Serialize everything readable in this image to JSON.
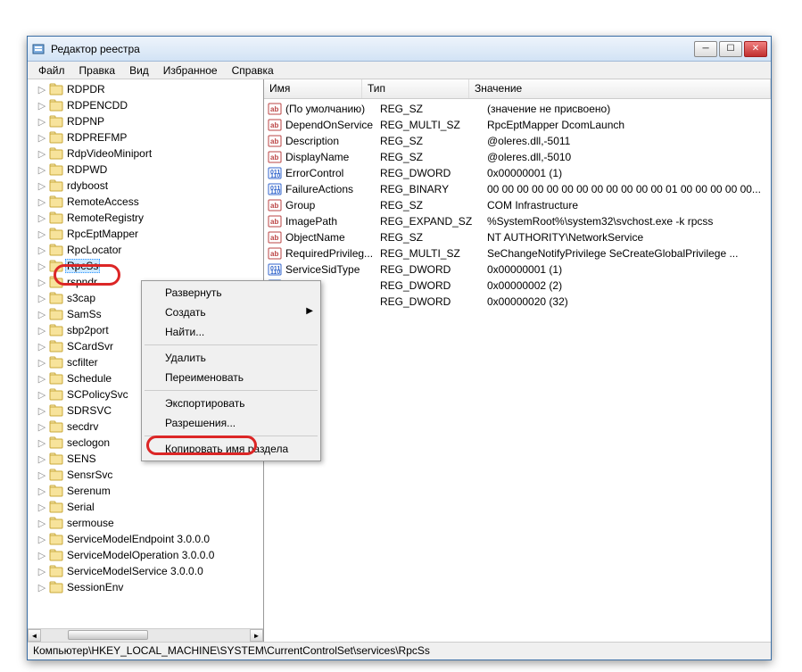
{
  "window": {
    "title": "Редактор реестра"
  },
  "menubar": [
    "Файл",
    "Правка",
    "Вид",
    "Избранное",
    "Справка"
  ],
  "tree": {
    "items": [
      "RDPDR",
      "RDPENCDD",
      "RDPNP",
      "RDPREFMP",
      "RdpVideoMiniport",
      "RDPWD",
      "rdyboost",
      "RemoteAccess",
      "RemoteRegistry",
      "RpcEptMapper",
      "RpcLocator",
      "RpcSs",
      "rspndr",
      "s3cap",
      "SamSs",
      "sbp2port",
      "SCardSvr",
      "scfilter",
      "Schedule",
      "SCPolicySvc",
      "SDRSVC",
      "secdrv",
      "seclogon",
      "SENS",
      "SensrSvc",
      "Serenum",
      "Serial",
      "sermouse",
      "ServiceModelEndpoint 3.0.0.0",
      "ServiceModelOperation 3.0.0.0",
      "ServiceModelService 3.0.0.0",
      "SessionEnv"
    ],
    "selected_index": 11
  },
  "list": {
    "columns": {
      "name": "Имя",
      "type": "Тип",
      "value": "Значение"
    },
    "rows": [
      {
        "icon": "str",
        "name": "(По умолчанию)",
        "type": "REG_SZ",
        "value": "(значение не присвоено)"
      },
      {
        "icon": "str",
        "name": "DependOnService",
        "type": "REG_MULTI_SZ",
        "value": "RpcEptMapper DcomLaunch"
      },
      {
        "icon": "str",
        "name": "Description",
        "type": "REG_SZ",
        "value": "@oleres.dll,-5011"
      },
      {
        "icon": "str",
        "name": "DisplayName",
        "type": "REG_SZ",
        "value": "@oleres.dll,-5010"
      },
      {
        "icon": "bin",
        "name": "ErrorControl",
        "type": "REG_DWORD",
        "value": "0x00000001 (1)"
      },
      {
        "icon": "bin",
        "name": "FailureActions",
        "type": "REG_BINARY",
        "value": "00 00 00 00 00 00 00 00 00 00 00 00 01 00 00 00 00 00..."
      },
      {
        "icon": "str",
        "name": "Group",
        "type": "REG_SZ",
        "value": "COM Infrastructure"
      },
      {
        "icon": "str",
        "name": "ImagePath",
        "type": "REG_EXPAND_SZ",
        "value": "%SystemRoot%\\system32\\svchost.exe -k rpcss"
      },
      {
        "icon": "str",
        "name": "ObjectName",
        "type": "REG_SZ",
        "value": "NT AUTHORITY\\NetworkService"
      },
      {
        "icon": "str",
        "name": "RequiredPrivileg...",
        "type": "REG_MULTI_SZ",
        "value": "SeChangeNotifyPrivilege SeCreateGlobalPrivilege ..."
      },
      {
        "icon": "bin",
        "name": "ServiceSidType",
        "type": "REG_DWORD",
        "value": "0x00000001 (1)"
      },
      {
        "icon": "bin",
        "name": "",
        "type": "REG_DWORD",
        "value": "0x00000002 (2)"
      },
      {
        "icon": "bin",
        "name": "",
        "type": "REG_DWORD",
        "value": "0x00000020 (32)"
      }
    ]
  },
  "context_menu": {
    "items": [
      {
        "label": "Развернуть",
        "sep_after": false
      },
      {
        "label": "Создать",
        "submenu": true
      },
      {
        "label": "Найти...",
        "sep_after": true
      },
      {
        "label": "Удалить"
      },
      {
        "label": "Переименовать",
        "sep_after": true
      },
      {
        "label": "Экспортировать"
      },
      {
        "label": "Разрешения...",
        "sep_after": true
      },
      {
        "label": "Копировать имя раздела"
      }
    ]
  },
  "statusbar": {
    "path": "Компьютер\\HKEY_LOCAL_MACHINE\\SYSTEM\\CurrentControlSet\\services\\RpcSs"
  }
}
